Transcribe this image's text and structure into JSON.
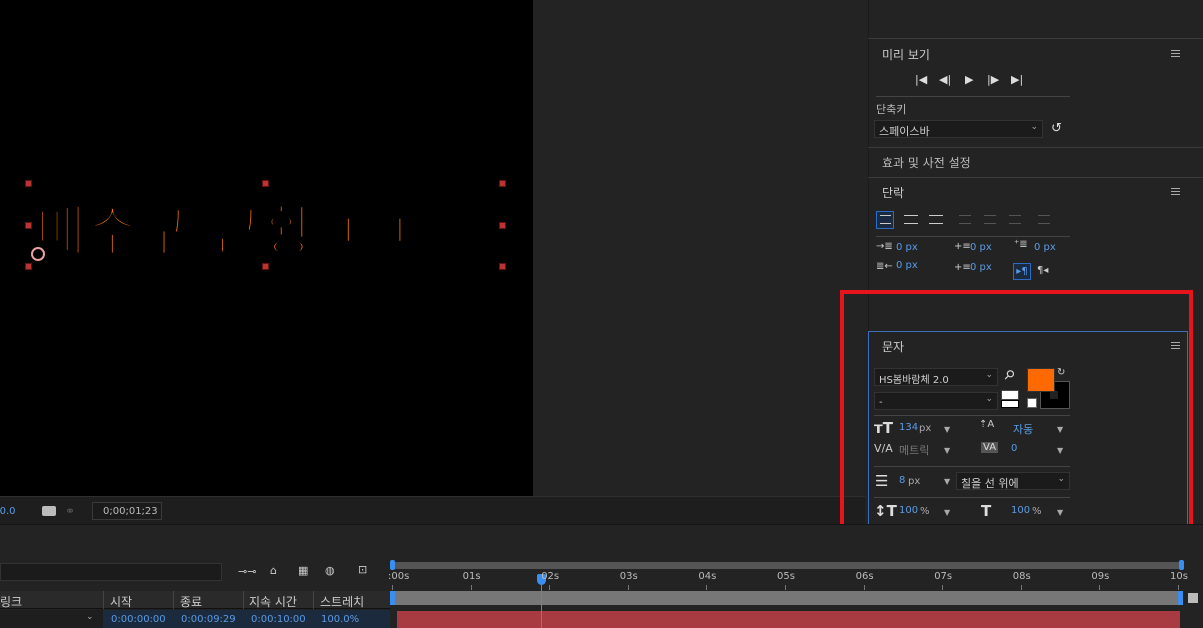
{
  "viewer": {
    "text": "배수구 근황 ㄷㄷ",
    "text_color": "#ff7a00",
    "zoom": "-0.0",
    "timecode": "0;00;01;23"
  },
  "preview": {
    "title": "미리 보기",
    "shortcut_label": "단축키",
    "shortcut_value": "스페이스바"
  },
  "effects": {
    "title": "효과 및 사전 설정"
  },
  "paragraph": {
    "title": "단락",
    "indent_left": "0 px",
    "space_before": "0 px",
    "indent_first": "0 px",
    "indent_right": "0 px",
    "space_after": "0 px"
  },
  "character": {
    "title": "문자",
    "font": "HS봄바람체 2.0",
    "style": "-",
    "fill_color": "#ff6a00",
    "stroke_color": "#000000",
    "font_size": "134",
    "font_size_unit": "px",
    "leading": "자동",
    "kerning": "메트릭",
    "tracking": "0",
    "stroke_width": "8",
    "stroke_width_unit": "px",
    "stroke_type": "칠을 선 위에",
    "vscale": "100",
    "vscale_unit": "%",
    "hscale": "100",
    "hscale_unit": "%"
  },
  "timeline": {
    "ticks": [
      ":00s",
      "01s",
      "02s",
      "03s",
      "04s",
      "05s",
      "06s",
      "07s",
      "08s",
      "09s",
      "10s"
    ],
    "col_link": "링크",
    "col_start": "시작",
    "col_end": "종료",
    "col_duration": "지속 시간",
    "col_stretch": "스트레치",
    "row_start": "0:00:00:00",
    "row_end": "0:00:09:29",
    "row_duration": "0:00:10:00",
    "row_stretch": "100.0%",
    "playhead_fraction": 0.19
  }
}
